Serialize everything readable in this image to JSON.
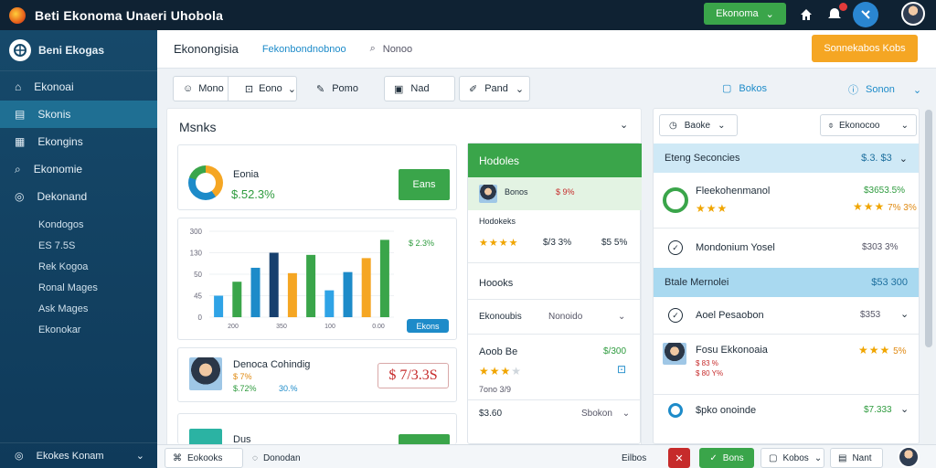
{
  "app": {
    "title": "Beti Ekonoma Unaeri Uhobola",
    "topbar_button": "Ekonoma"
  },
  "sidebar": {
    "brand": "Beni Ekogas",
    "items": [
      {
        "label": "Ekonoai",
        "icon": "home-icon"
      },
      {
        "label": "Skonis",
        "icon": "book-icon"
      },
      {
        "label": "Ekongins",
        "icon": "document-icon"
      },
      {
        "label": "Ekonomie",
        "icon": "search-icon"
      },
      {
        "label": "Dekonand",
        "icon": "settings-icon"
      }
    ],
    "subitems": [
      "Kondogos",
      "ES 7.5S",
      "Rek Kogoa",
      "Ronal Mages",
      "Ask Mages",
      "Ekonokar"
    ],
    "footer": "Ekokes Konam"
  },
  "header": {
    "title": "Ekonongisia",
    "link": "Fekonbondnobnoo",
    "search": "Nonoo",
    "orange_button": "Sonnekabos Kobs"
  },
  "toolbar": {
    "b1": "Mono",
    "b2": "Eono",
    "b3": "Pomo",
    "b4": "Nad",
    "b5": "Pand",
    "link1": "Bokos",
    "link2": "Sonon"
  },
  "left": {
    "panel_title": "Msnks",
    "summary_label": "Eonia",
    "summary_value": "$.52.3%",
    "summary_button": "Eans",
    "chart_annotation": "$ 2.3%",
    "chart_button": "Ekons",
    "person_name": "Denoca Cohindig",
    "person_v1": "$ 7%",
    "person_v2": "$.72%",
    "person_v3": "30.%",
    "person_price": "$ 7/3.3S",
    "bottom_name": "Dus"
  },
  "chart_data": {
    "type": "bar",
    "yticks": [
      "300",
      "130",
      "50",
      "45",
      "0"
    ],
    "xticks": [
      "200",
      "350",
      "100",
      "0.00"
    ],
    "values": [
      20,
      33,
      46,
      60,
      41,
      58,
      25,
      42,
      55,
      72
    ],
    "colors": [
      "#2fa3e6",
      "#3aa54a",
      "#1d8bc9",
      "#17406e",
      "#f5a623",
      "#3aa54a",
      "#2fa3e6",
      "#1d8bc9",
      "#f5a623",
      "#3aa54a"
    ],
    "ylim": [
      0,
      80
    ]
  },
  "middle": {
    "header": "Hodoles",
    "row1_name": "Bonos",
    "row1_value": "$ 9%",
    "sub": "Hodokeks",
    "stat1": "$/3 3%",
    "stat2": "$5 5%",
    "section_title": "Hoooks",
    "dropdown_label": "Ekonoubis",
    "dropdown_value": "Nonoido",
    "item_name": "Aoob Be",
    "item_value": "$/300",
    "item_sub": "7ono 3/9",
    "bottom_left": "$3.60",
    "bottom_right": "Sbokon"
  },
  "right": {
    "dd1": "Baoke",
    "dd2": "Ekonocoo",
    "blue_header": "Eteng Seconcies",
    "blue_header_value": "$.3. $3",
    "r1_name": "Fleekohenmanol",
    "r1_value": "$3653.5%",
    "r1_value2": "7% 3%",
    "r2_name": "Mondonium Yosel",
    "r2_value": "$303 3%",
    "section2": "Btale Mernolei",
    "section2_value": "$53 300",
    "r3_name": "Aoel Pesaobon",
    "r3_value": "$353",
    "r4_name": "Fosu Ekkonoaia",
    "r4_sub1": "$ 83 %",
    "r4_sub2": "$ 80 Y%",
    "r4_value": "5%",
    "r5_name": "$pko onoinde",
    "r5_value": "$7.333"
  },
  "bottom": {
    "b1": "Eokooks",
    "b2": "Donodan",
    "b3": "Eilbos",
    "b4": "Bons",
    "b5": "Kobos",
    "b6": "Nant"
  }
}
